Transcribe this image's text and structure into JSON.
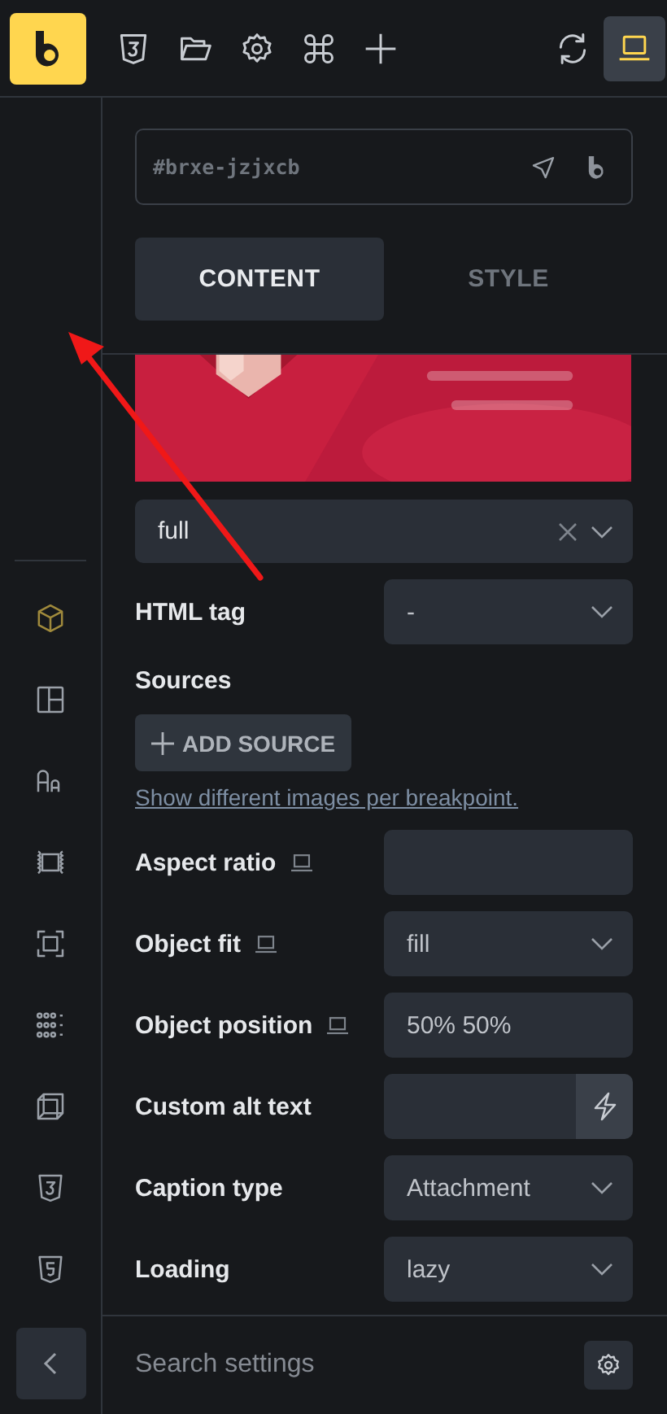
{
  "toolbar": {
    "items": [
      {
        "kind": "css",
        "selected": false
      },
      {
        "kind": "folder",
        "selected": false
      },
      {
        "kind": "settings",
        "selected": false
      },
      {
        "kind": "command",
        "selected": false
      },
      {
        "kind": "add",
        "selected": false
      }
    ],
    "right_items": [
      {
        "kind": "refresh",
        "selected": false
      },
      {
        "kind": "laptop",
        "selected": true
      }
    ]
  },
  "rail": {
    "items": [
      {
        "kind": "cube",
        "selected": true
      },
      {
        "kind": "layout",
        "selected": false
      },
      {
        "kind": "typography",
        "selected": false
      },
      {
        "kind": "frame",
        "selected": false
      },
      {
        "kind": "focus",
        "selected": false
      },
      {
        "kind": "grid",
        "selected": false
      },
      {
        "kind": "box3d",
        "selected": false
      },
      {
        "kind": "css",
        "selected": false
      },
      {
        "kind": "html",
        "selected": false
      }
    ]
  },
  "panel": {
    "element_id": "#brxe-jzjxcb",
    "tabs": [
      {
        "label": "CONTENT",
        "selected": true
      },
      {
        "label": "STYLE",
        "selected": false
      }
    ],
    "image_size": {
      "value": "full",
      "clearable": true
    },
    "html_tag": {
      "label": "HTML tag",
      "value": "-"
    },
    "sources": {
      "label": "Sources",
      "button": "ADD SOURCE",
      "link": "Show different images per breakpoint."
    },
    "fields": [
      {
        "label": "Aspect ratio",
        "responsive": true,
        "kind": "input"
      },
      {
        "label": "Object fit",
        "responsive": true,
        "kind": "select",
        "value": "fill"
      },
      {
        "label": "Object position",
        "responsive": true,
        "kind": "input",
        "value": "50% 50%"
      },
      {
        "label": "Custom alt text",
        "responsive": false,
        "kind": "action"
      },
      {
        "label": "Caption type",
        "responsive": false,
        "kind": "select",
        "value": "Attachment"
      },
      {
        "label": "Loading",
        "responsive": false,
        "kind": "select",
        "value": "lazy"
      }
    ],
    "search": {
      "placeholder": "Search settings"
    }
  }
}
